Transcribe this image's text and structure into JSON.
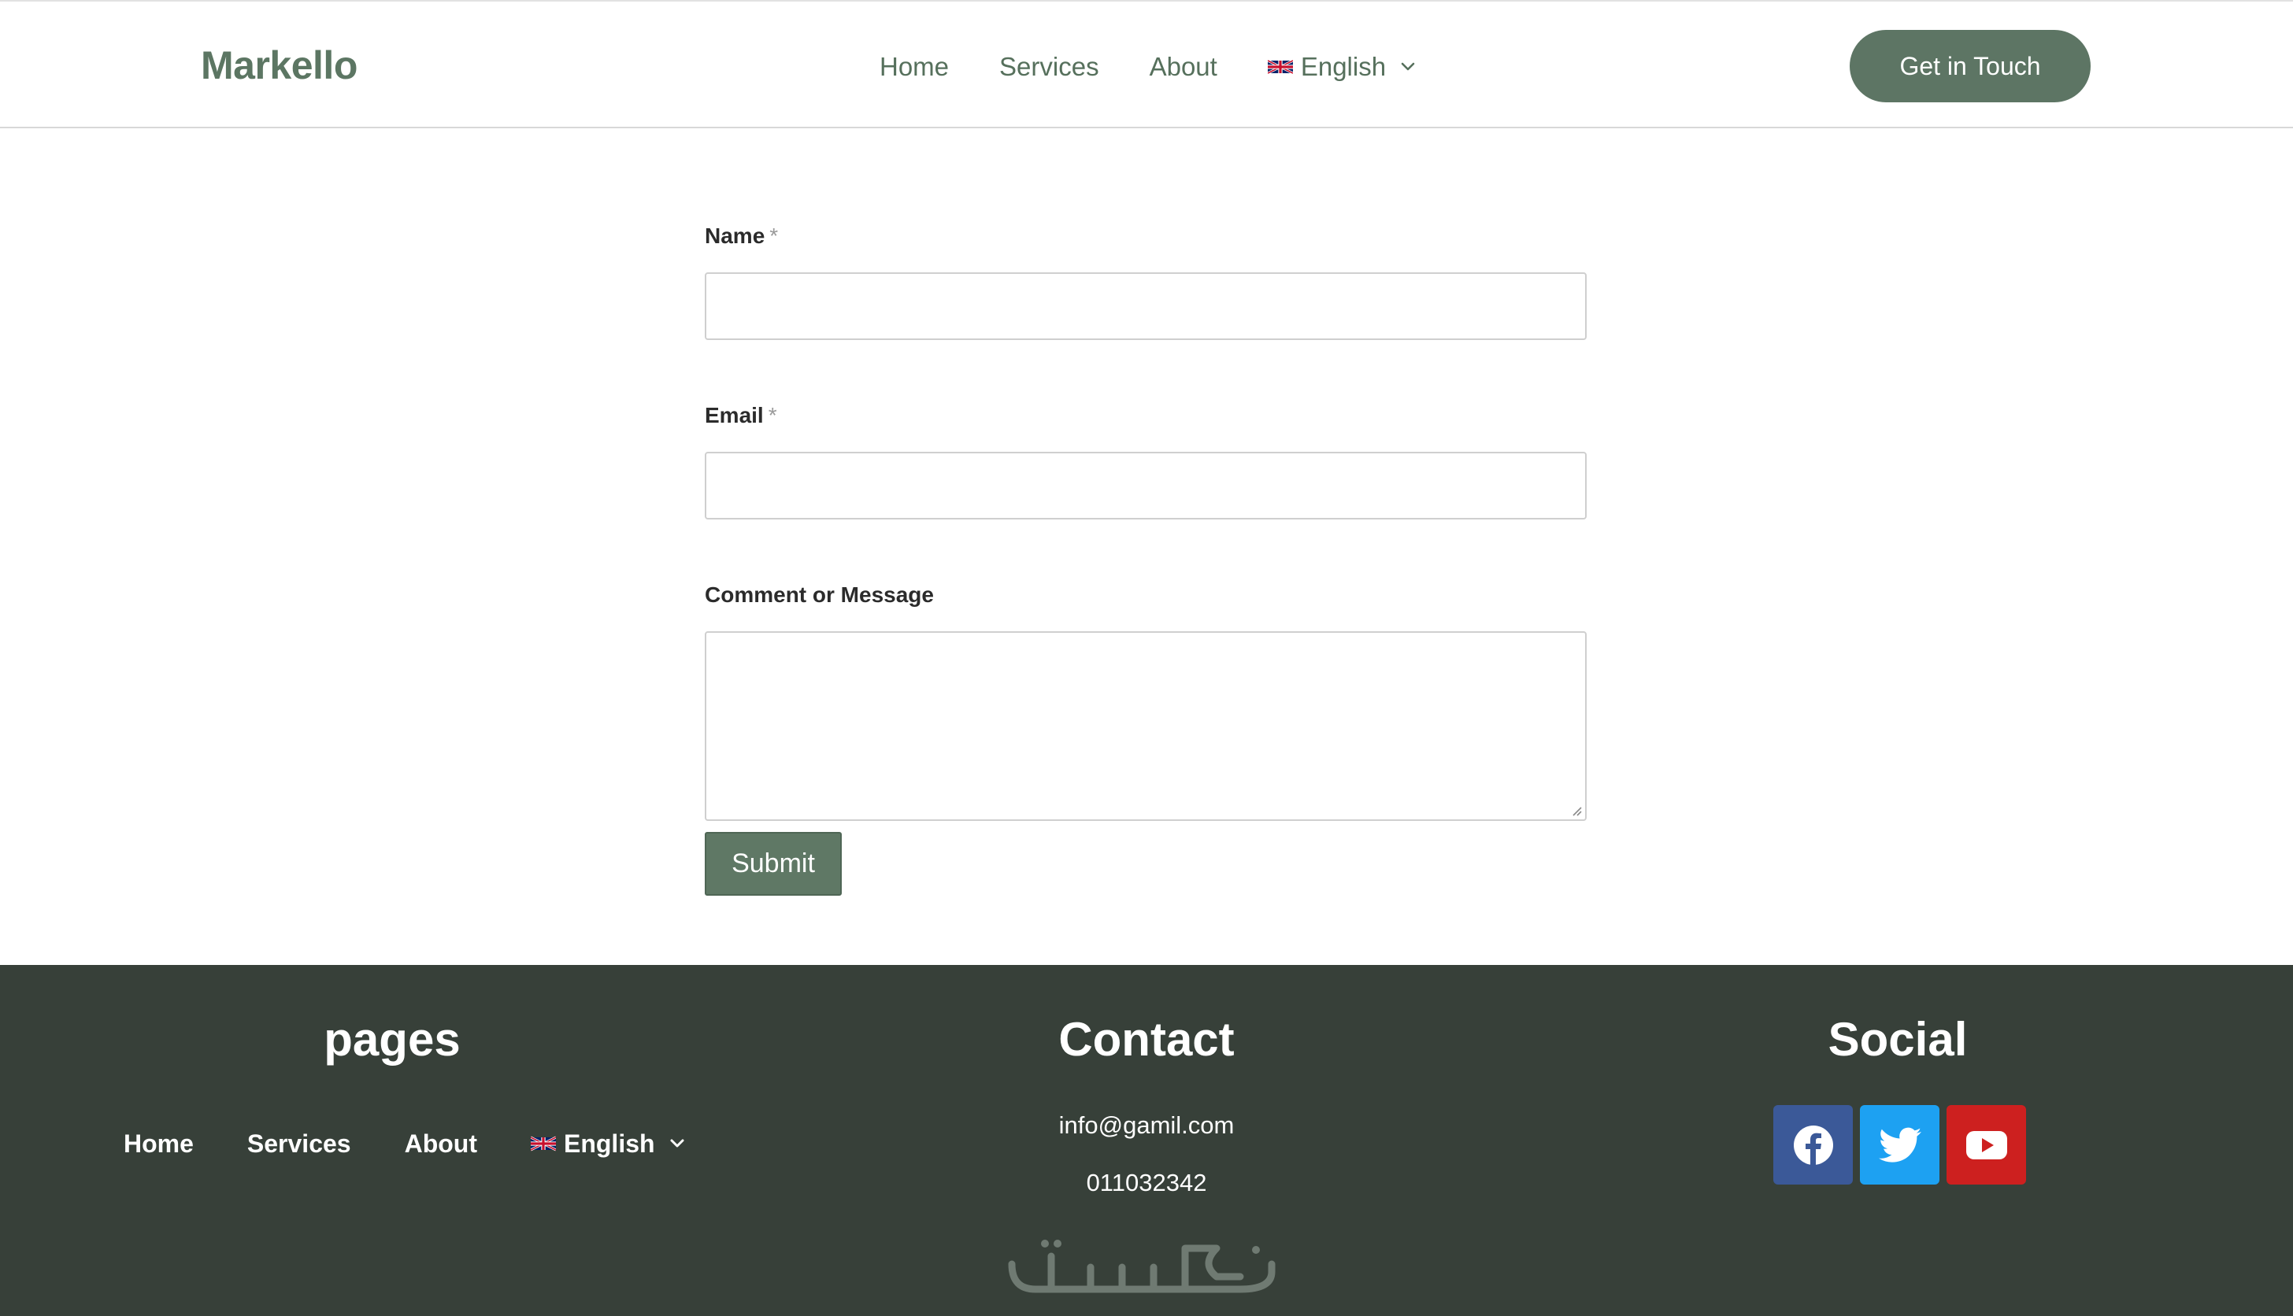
{
  "header": {
    "logo": "Markello",
    "nav": {
      "home": "Home",
      "services": "Services",
      "about": "About",
      "language": "English"
    },
    "cta": "Get in Touch"
  },
  "form": {
    "name_label": "Name",
    "name_required": "*",
    "name_value": "",
    "email_label": "Email",
    "email_required": "*",
    "email_value": "",
    "message_label": "Comment or Message",
    "message_value": "",
    "submit_label": "Submit"
  },
  "footer": {
    "pages_heading": "pages",
    "nav": {
      "home": "Home",
      "services": "Services",
      "about": "About",
      "language": "English"
    },
    "contact_heading": "Contact",
    "email": "info@gamil.com",
    "phone": "011032342",
    "social_heading": "Social",
    "watermark_text": "خمسات",
    "social_links": [
      "facebook-icon",
      "twitter-icon",
      "youtube-icon"
    ]
  },
  "colors": {
    "brand_green": "#5d7564",
    "footer_bg": "#374039",
    "facebook": "#3b5998",
    "twitter": "#1da1f2",
    "youtube": "#cd201f"
  }
}
